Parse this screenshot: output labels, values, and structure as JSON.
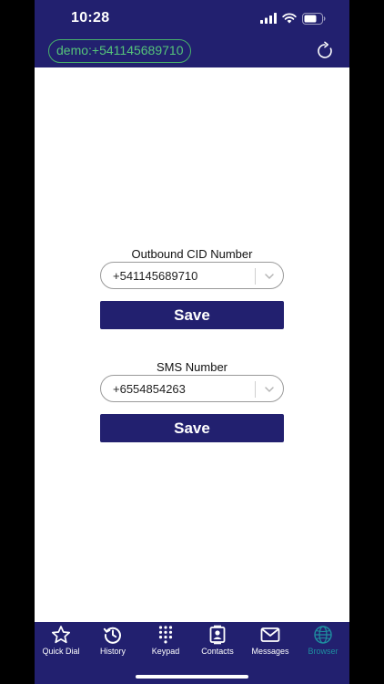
{
  "status_bar": {
    "time": "10:28"
  },
  "header": {
    "account_label": "demo:+541145689710"
  },
  "outbound_cid": {
    "label": "Outbound CID Number",
    "selected_value": "+541145689710",
    "save_label": "Save"
  },
  "sms_number": {
    "label": "SMS Number",
    "selected_value": "+6554854263",
    "save_label": "Save"
  },
  "tabs": [
    {
      "label": "Quick Dial",
      "icon": "star-icon"
    },
    {
      "label": "History",
      "icon": "history-icon"
    },
    {
      "label": "Keypad",
      "icon": "keypad-icon"
    },
    {
      "label": "Contacts",
      "icon": "contacts-icon"
    },
    {
      "label": "Messages",
      "icon": "envelope-icon"
    },
    {
      "label": "Browser",
      "icon": "globe-icon"
    }
  ],
  "active_tab": "Browser",
  "colors": {
    "nav_background": "#22206f",
    "account_text": "#55c47a",
    "active_tab": "#1e8fa0"
  }
}
